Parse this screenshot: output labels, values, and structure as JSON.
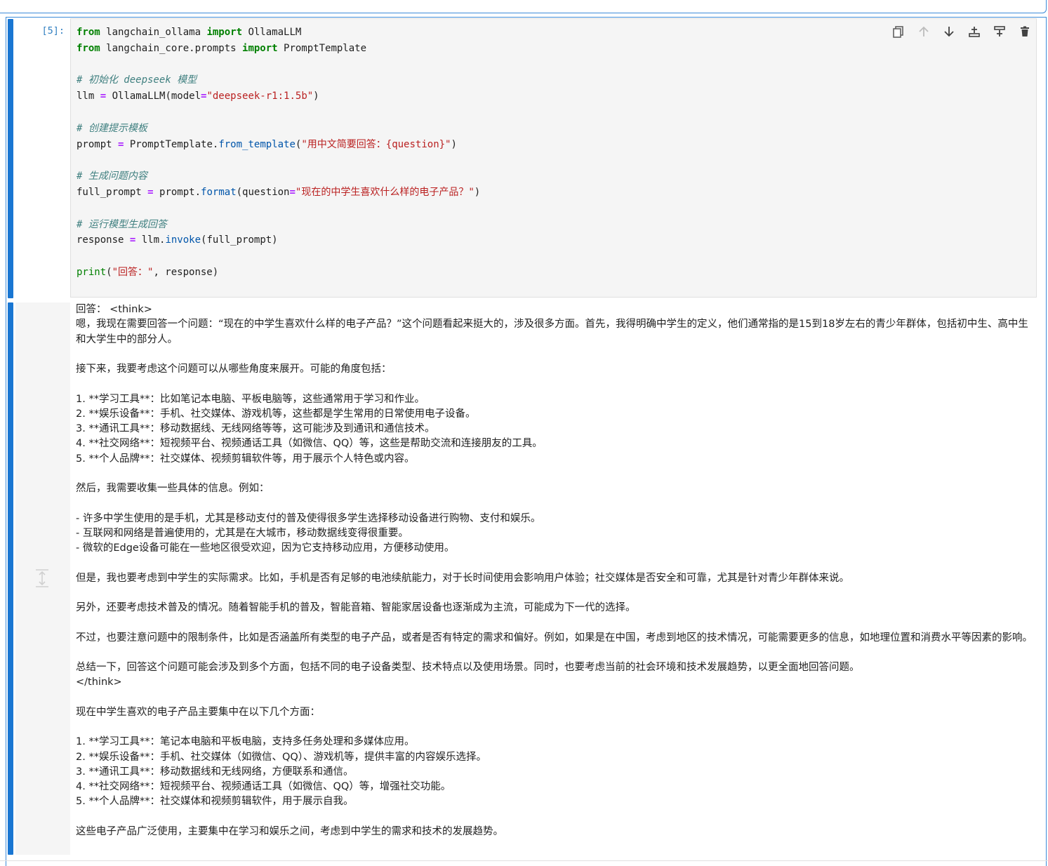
{
  "cell": {
    "prompt": "[5]:",
    "code_lines": [
      [
        {
          "t": "from",
          "c": "kw"
        },
        {
          "t": " langchain_ollama "
        },
        {
          "t": "import",
          "c": "kw"
        },
        {
          "t": " OllamaLLM"
        }
      ],
      [
        {
          "t": "from",
          "c": "kw"
        },
        {
          "t": " langchain_core.prompts "
        },
        {
          "t": "import",
          "c": "kw"
        },
        {
          "t": " PromptTemplate"
        }
      ],
      [],
      [
        {
          "t": "# 初始化 deepseek 模型",
          "c": "cm"
        }
      ],
      [
        {
          "t": "llm "
        },
        {
          "t": "=",
          "c": "op"
        },
        {
          "t": " OllamaLLM(model"
        },
        {
          "t": "=",
          "c": "op"
        },
        {
          "t": "\"deepseek-r1:1.5b\"",
          "c": "str"
        },
        {
          "t": ")"
        }
      ],
      [],
      [
        {
          "t": "# 创建提示模板",
          "c": "cm"
        }
      ],
      [
        {
          "t": "prompt "
        },
        {
          "t": "=",
          "c": "op"
        },
        {
          "t": " PromptTemplate"
        },
        {
          "t": "."
        },
        {
          "t": "from_template",
          "c": "fn"
        },
        {
          "t": "("
        },
        {
          "t": "\"用中文简要回答：{question}\"",
          "c": "str"
        },
        {
          "t": ")"
        }
      ],
      [],
      [
        {
          "t": "# 生成问题内容",
          "c": "cm"
        }
      ],
      [
        {
          "t": "full_prompt "
        },
        {
          "t": "=",
          "c": "op"
        },
        {
          "t": " prompt"
        },
        {
          "t": "."
        },
        {
          "t": "format",
          "c": "fn"
        },
        {
          "t": "(question"
        },
        {
          "t": "=",
          "c": "op"
        },
        {
          "t": "\"现在的中学生喜欢什么样的电子产品？\"",
          "c": "str"
        },
        {
          "t": ")"
        }
      ],
      [],
      [
        {
          "t": "# 运行模型生成回答",
          "c": "cm"
        }
      ],
      [
        {
          "t": "response "
        },
        {
          "t": "=",
          "c": "op"
        },
        {
          "t": " llm"
        },
        {
          "t": "."
        },
        {
          "t": "invoke",
          "c": "fn"
        },
        {
          "t": "(full_prompt)"
        }
      ],
      [],
      [
        {
          "t": "print",
          "c": "bi"
        },
        {
          "t": "("
        },
        {
          "t": "\"回答：\"",
          "c": "str"
        },
        {
          "t": ", response)"
        }
      ]
    ]
  },
  "toolbar": {
    "buttons": [
      {
        "name": "duplicate-cell-button",
        "icon": "copy-icon"
      },
      {
        "name": "move-up-button",
        "icon": "arrow-up-icon"
      },
      {
        "name": "move-down-button",
        "icon": "arrow-down-icon"
      },
      {
        "name": "insert-above-button",
        "icon": "insert-above-icon"
      },
      {
        "name": "insert-below-button",
        "icon": "insert-below-icon"
      },
      {
        "name": "delete-cell-button",
        "icon": "trash-icon"
      }
    ]
  },
  "output": {
    "lines": [
      "回答： <think>",
      "嗯，我现在需要回答一个问题：“现在的中学生喜欢什么样的电子产品？”这个问题看起来挺大的，涉及很多方面。首先，我得明确中学生的定义，他们通常指的是15到18岁左右的青少年群体，包括初中生、高中生和大学生中的部分人。",
      "",
      "接下来，我要考虑这个问题可以从哪些角度来展开。可能的角度包括：",
      "",
      "1. **学习工具**：比如笔记本电脑、平板电脑等，这些通常用于学习和作业。",
      "2. **娱乐设备**：手机、社交媒体、游戏机等，这些都是学生常用的日常使用电子设备。",
      "3. **通讯工具**：移动数据线、无线网络等等，这可能涉及到通讯和通信技术。",
      "4. **社交网络**：短视频平台、视频通话工具（如微信、QQ）等，这些是帮助交流和连接朋友的工具。",
      "5. **个人品牌**：社交媒体、视频剪辑软件等，用于展示个人特色或内容。",
      "",
      "然后，我需要收集一些具体的信息。例如：",
      "",
      "- 许多中学生使用的是手机，尤其是移动支付的普及使得很多学生选择移动设备进行购物、支付和娱乐。",
      "- 互联网和网络是普遍使用的，尤其是在大城市，移动数据线变得很重要。",
      "- 微软的Edge设备可能在一些地区很受欢迎，因为它支持移动应用，方便移动使用。",
      "",
      "但是，我也要考虑到中学生的实际需求。比如，手机是否有足够的电池续航能力，对于长时间使用会影响用户体验；社交媒体是否安全和可靠，尤其是针对青少年群体来说。",
      "",
      "另外，还要考虑技术普及的情况。随着智能手机的普及，智能音箱、智能家居设备也逐渐成为主流，可能成为下一代的选择。",
      "",
      "不过，也要注意问题中的限制条件，比如是否涵盖所有类型的电子产品，或者是否有特定的需求和偏好。例如，如果是在中国，考虑到地区的技术情况，可能需要更多的信息，如地理位置和消费水平等因素的影响。",
      "",
      "总结一下，回答这个问题可能会涉及到多个方面，包括不同的电子设备类型、技术特点以及使用场景。同时，也要考虑当前的社会环境和技术发展趋势，以更全面地回答问题。",
      "</think>",
      "",
      "现在中学生喜欢的电子产品主要集中在以下几个方面：",
      "",
      "1. **学习工具**：笔记本电脑和平板电脑，支持多任务处理和多媒体应用。",
      "2. **娱乐设备**：手机、社交媒体（如微信、QQ）、游戏机等，提供丰富的内容娱乐选择。",
      "3. **通讯工具**：移动数据线和无线网络，方便联系和通信。",
      "4. **社交网络**：短视频平台、视频通话工具（如微信、QQ）等，增强社交功能。",
      "5. **个人品牌**：社交媒体和视频剪辑软件，用于展示自我。",
      "",
      "这些电子产品广泛使用，主要集中在学习和娱乐之间，考虑到中学生的需求和技术的发展趋势。"
    ]
  },
  "colors": {
    "accent": "#1976d2",
    "keyword": "#008000",
    "string": "#ba2121",
    "comment": "#408080",
    "operator": "#aa22ff"
  }
}
